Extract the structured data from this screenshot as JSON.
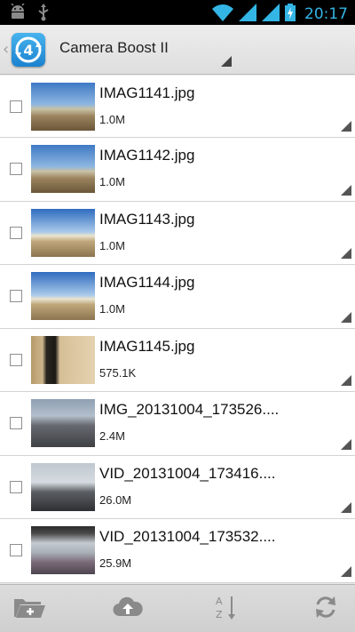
{
  "status_bar": {
    "time": "20:17",
    "icons": [
      "android-icon",
      "usb-icon",
      "wifi-icon",
      "signal-icon",
      "signal-icon",
      "battery-charging-icon"
    ]
  },
  "action_bar": {
    "back_glyph": "‹",
    "app_icon": "camera-boost-app-icon",
    "title": "Camera Boost II"
  },
  "files": [
    {
      "name": "IMAG1141.jpg",
      "size": "1.0M",
      "thumb": "beach"
    },
    {
      "name": "IMAG1142.jpg",
      "size": "1.0M",
      "thumb": "beach"
    },
    {
      "name": "IMAG1143.jpg",
      "size": "1.0M",
      "thumb": "beach2"
    },
    {
      "name": "IMAG1144.jpg",
      "size": "1.0M",
      "thumb": "beach2"
    },
    {
      "name": "IMAG1145.jpg",
      "size": "575.1K",
      "thumb": "bottle"
    },
    {
      "name": "IMG_20131004_173526....",
      "size": "2.4M",
      "thumb": "street"
    },
    {
      "name": "VID_20131004_173416....",
      "size": "26.0M",
      "thumb": "street2"
    },
    {
      "name": "VID_20131004_173532....",
      "size": "25.9M",
      "thumb": "bridge"
    }
  ],
  "toolbar": {
    "buttons": [
      "add-folder-icon",
      "cloud-upload-icon",
      "sort-az-icon",
      "refresh-icon"
    ]
  }
}
